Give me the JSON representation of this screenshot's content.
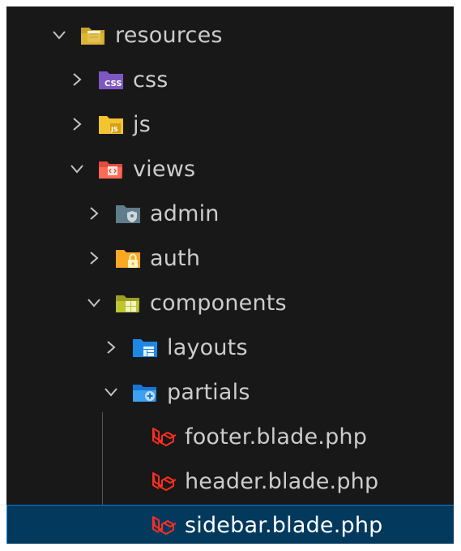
{
  "explorer": {
    "items": [
      {
        "label": "resources",
        "expanded": true,
        "icon": "folder-resources-open-icon"
      },
      {
        "label": "css",
        "expanded": false,
        "icon": "folder-css-icon"
      },
      {
        "label": "js",
        "expanded": false,
        "icon": "folder-js-icon"
      },
      {
        "label": "views",
        "expanded": true,
        "icon": "folder-views-open-icon"
      },
      {
        "label": "admin",
        "expanded": false,
        "icon": "folder-admin-icon"
      },
      {
        "label": "auth",
        "expanded": false,
        "icon": "folder-auth-icon"
      },
      {
        "label": "components",
        "expanded": true,
        "icon": "folder-components-open-icon"
      },
      {
        "label": "layouts",
        "expanded": false,
        "icon": "folder-layouts-icon"
      },
      {
        "label": "partials",
        "expanded": true,
        "icon": "folder-partials-open-icon"
      },
      {
        "label": "footer.blade.php",
        "icon": "laravel-blade-file-icon"
      },
      {
        "label": "header.blade.php",
        "icon": "laravel-blade-file-icon"
      },
      {
        "label": "sidebar.blade.php",
        "icon": "laravel-blade-file-icon",
        "selected": true
      }
    ]
  },
  "colors": {
    "background": "#181818",
    "selection_background": "#04395e",
    "selection_border": "#0b7bd3",
    "text": "#cccccc",
    "laravel_red": "#ff2d20"
  }
}
